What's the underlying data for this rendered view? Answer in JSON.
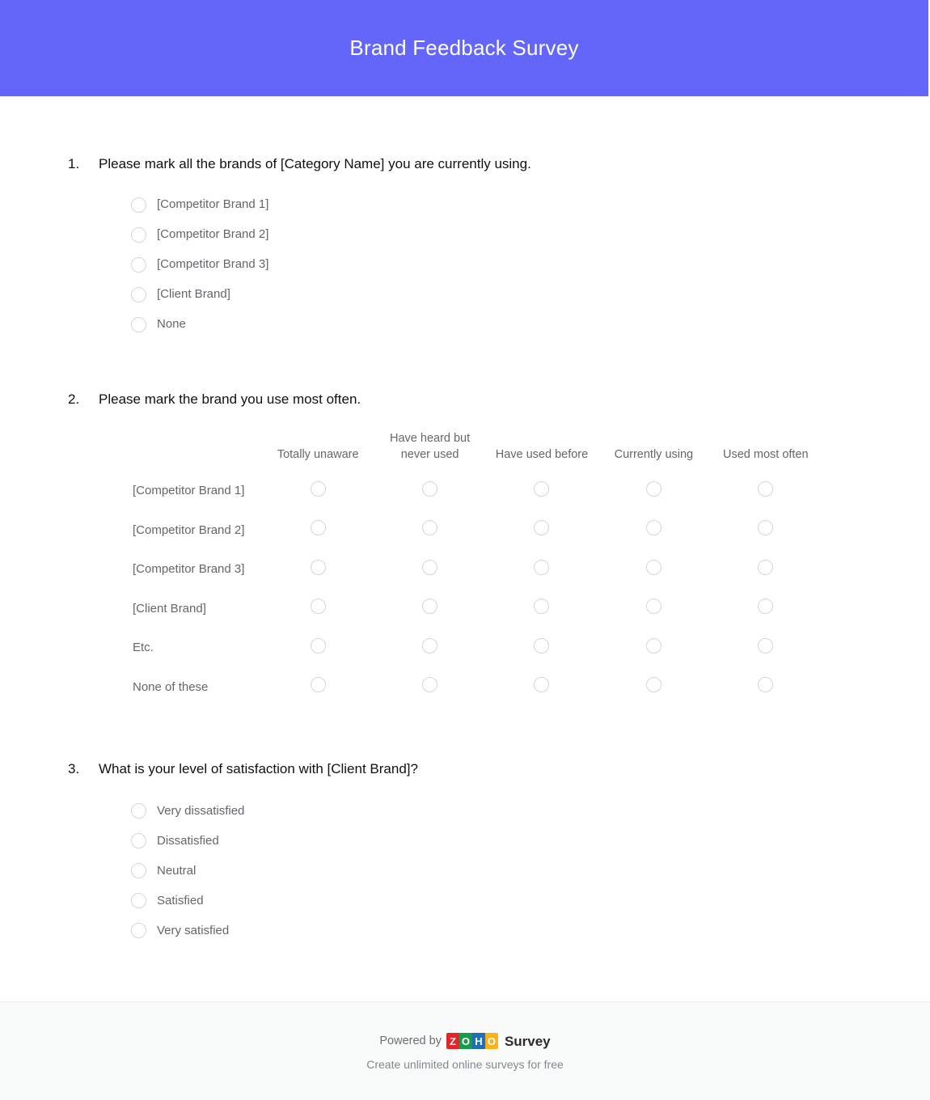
{
  "header": {
    "title": "Brand Feedback Survey",
    "background_color": "#6366f8",
    "text_color": "#ffffff"
  },
  "questions": [
    {
      "number": "1.",
      "text": "Please mark all the brands of [Category Name] you are currently using.",
      "type": "radio-list",
      "options": [
        "[Competitor Brand 1]",
        "[Competitor Brand 2]",
        "[Competitor Brand 3]",
        "[Client Brand]",
        "None"
      ]
    },
    {
      "number": "2.",
      "text": "Please mark the brand you use most often.",
      "type": "matrix",
      "columns": [
        "Totally unaware",
        "Have heard but never used",
        "Have used before",
        "Currently using",
        "Used most often"
      ],
      "rows": [
        "[Competitor Brand 1]",
        "[Competitor Brand 2]",
        "[Competitor Brand 3]",
        "[Client Brand]",
        "Etc.",
        "None of these"
      ]
    },
    {
      "number": "3.",
      "text": "What is your level of satisfaction with [Client Brand]?",
      "type": "radio-list",
      "options": [
        "Very dissatisfied",
        "Dissatisfied",
        "Neutral",
        "Satisfied",
        "Very satisfied"
      ]
    }
  ],
  "footer": {
    "powered_by": "Powered by",
    "brand_letters": [
      "Z",
      "O",
      "H",
      "O"
    ],
    "brand_colors": [
      "#e42527",
      "#199b4b",
      "#226db4",
      "#f9b21d"
    ],
    "product": "Survey",
    "tagline": "Create unlimited online surveys for free",
    "background_color": "#f9fafa"
  }
}
